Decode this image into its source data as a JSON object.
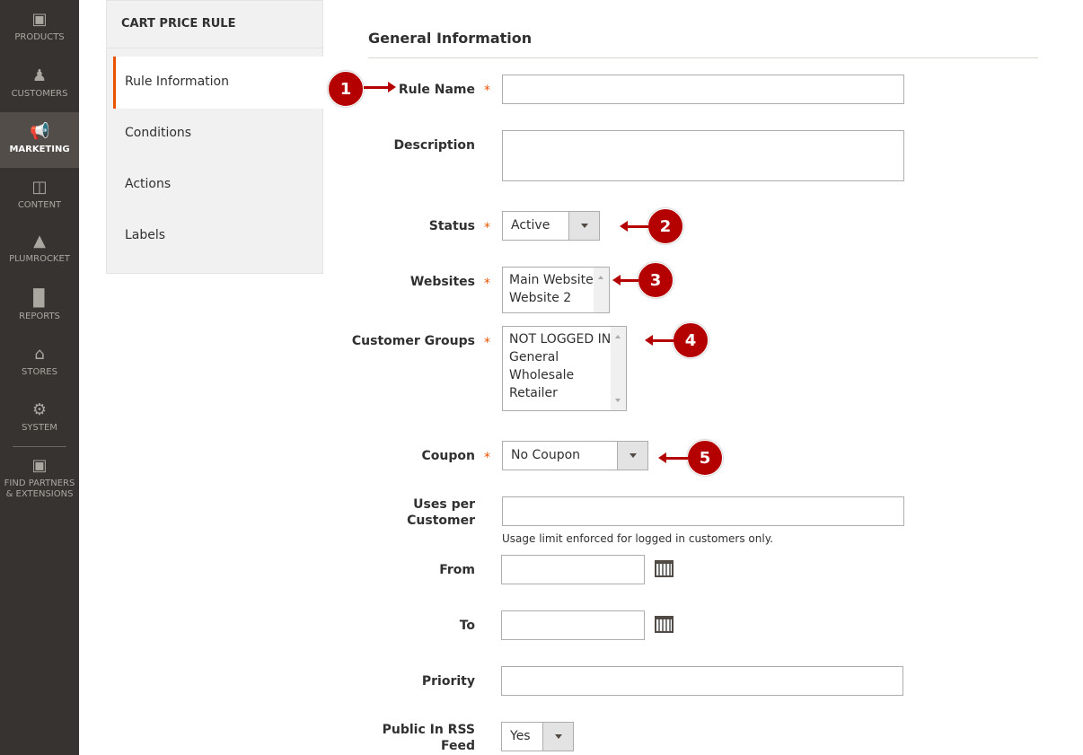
{
  "nav": [
    {
      "label": "PRODUCTS",
      "icon": "box-icon"
    },
    {
      "label": "CUSTOMERS",
      "icon": "person-icon"
    },
    {
      "label": "MARKETING",
      "icon": "megaphone-icon",
      "active": true
    },
    {
      "label": "CONTENT",
      "icon": "layout-icon"
    },
    {
      "label": "PLUMROCKET",
      "icon": "pyramid-icon"
    },
    {
      "label": "REPORTS",
      "icon": "bar-chart-icon"
    },
    {
      "label": "STORES",
      "icon": "storefront-icon"
    },
    {
      "label": "SYSTEM",
      "icon": "gear-icon"
    },
    {
      "label": "FIND PARTNERS & EXTENSIONS",
      "icon": "lego-brick-icon"
    }
  ],
  "panel": {
    "title": "CART PRICE RULE",
    "tabs": [
      "Rule Information",
      "Conditions",
      "Actions",
      "Labels"
    ],
    "active_tab": "Rule Information"
  },
  "form": {
    "section_title": "General Information",
    "rule_name": {
      "label": "Rule Name",
      "value": ""
    },
    "description": {
      "label": "Description",
      "value": ""
    },
    "status": {
      "label": "Status",
      "value": "Active"
    },
    "websites": {
      "label": "Websites",
      "options": [
        "Main Website",
        "Website 2"
      ]
    },
    "customer_groups": {
      "label": "Customer Groups",
      "options": [
        "NOT LOGGED IN",
        "General",
        "Wholesale",
        "Retailer"
      ]
    },
    "coupon": {
      "label": "Coupon",
      "value": "No Coupon"
    },
    "uses_per_customer": {
      "label_1": "Uses per",
      "label_2": "Customer",
      "value": "",
      "note": "Usage limit enforced for logged in customers only."
    },
    "from": {
      "label": "From",
      "value": ""
    },
    "to": {
      "label": "To",
      "value": ""
    },
    "priority": {
      "label": "Priority",
      "value": ""
    },
    "rss": {
      "label_1": "Public In RSS",
      "label_2": "Feed",
      "value": "Yes"
    },
    "required_mark": "*"
  },
  "annotations": [
    "1",
    "2",
    "3",
    "4",
    "5"
  ],
  "colors": {
    "nav_bg": "#373330",
    "accent": "#eb5202",
    "annotation": "#b50000"
  }
}
